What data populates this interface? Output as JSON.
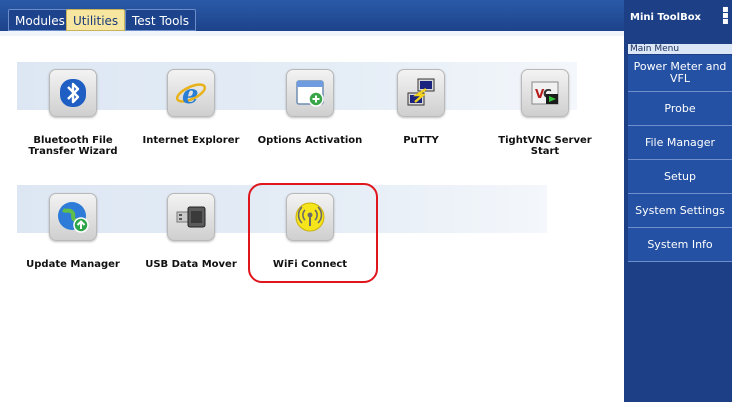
{
  "tabs": [
    {
      "label": "Modules",
      "active": false
    },
    {
      "label": "Utilities",
      "active": true
    },
    {
      "label": "Test Tools",
      "active": false
    }
  ],
  "apps_row1": [
    {
      "label": "Bluetooth File Transfer Wizard",
      "icon": "bluetooth-icon"
    },
    {
      "label": "Internet Explorer",
      "icon": "internet-explorer-icon"
    },
    {
      "label": "Options Activation",
      "icon": "window-plus-icon"
    },
    {
      "label": "PuTTY",
      "icon": "putty-icon"
    },
    {
      "label": "TightVNC Server Start",
      "icon": "vnc-icon"
    }
  ],
  "apps_row2": [
    {
      "label": "Update Manager",
      "icon": "globe-update-icon"
    },
    {
      "label": "USB Data Mover",
      "icon": "usb-drive-icon"
    },
    {
      "label": "WiFi Connect",
      "icon": "wifi-antenna-icon"
    }
  ],
  "toolbox": {
    "title": "Mini ToolBox",
    "section": "Main Menu",
    "items": [
      "Power Meter and VFL",
      "Probe",
      "File Manager",
      "Setup",
      "System Settings",
      "System Info"
    ]
  },
  "colors": {
    "highlight": "#e0161d",
    "toolbox_bg": "#1c3f86",
    "active_tab": "#f7e6a0"
  }
}
